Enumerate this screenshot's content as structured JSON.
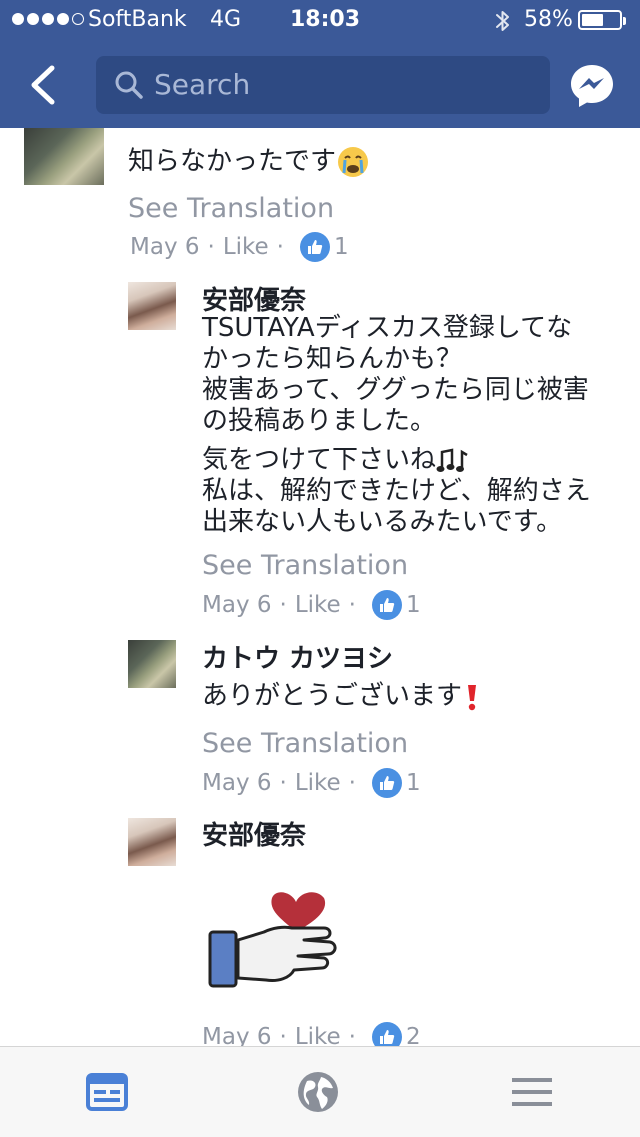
{
  "status_bar": {
    "carrier": "SoftBank",
    "network": "4G",
    "time": "18:03",
    "battery": "58%",
    "battery_level": 0.58
  },
  "header": {
    "search_placeholder": "Search",
    "icons": [
      "back-chevron-icon",
      "search-icon",
      "messenger-icon"
    ]
  },
  "comments": [
    {
      "text": "知らなかったです",
      "emoji": "crying-face",
      "see_translation": "See Translation",
      "date": "May 6",
      "separator": "·",
      "like": "Like",
      "likes": "1"
    },
    {
      "name": "安部優奈",
      "lines": [
        "TSUTAYAディスカス登録してな",
        "かったら知らんかも？",
        "被害あって、ググったら同じ被害",
        "の投稿ありました。"
      ],
      "lines2": [
        "気をつけて下さいね",
        "私は、解約できたけど、解約さえ",
        "出来ない人もいるみたいです。"
      ],
      "emoji": "musical-notes",
      "see_translation": "See Translation",
      "date": "May 6",
      "separator": "·",
      "like": "Like",
      "likes": "1"
    },
    {
      "name": "カトウ カツヨシ",
      "text": "ありがとうございます",
      "emoji": "exclamation",
      "see_translation": "See Translation",
      "date": "May 6",
      "separator": "·",
      "like": "Like",
      "likes": "1"
    },
    {
      "name": "安部優奈",
      "sticker": "hand-holding-heart",
      "date": "May 6",
      "separator": "·",
      "like": "Like",
      "likes": "2"
    }
  ],
  "colors": {
    "header": "#3b5998",
    "search_bg": "#2e4a83",
    "like_blue": "#4a90e2",
    "meta_gray": "#9197a3",
    "active_tab": "#4a80d6"
  },
  "tabbar": {
    "icons": [
      "news-feed-icon",
      "globe-icon",
      "menu-icon"
    ]
  }
}
